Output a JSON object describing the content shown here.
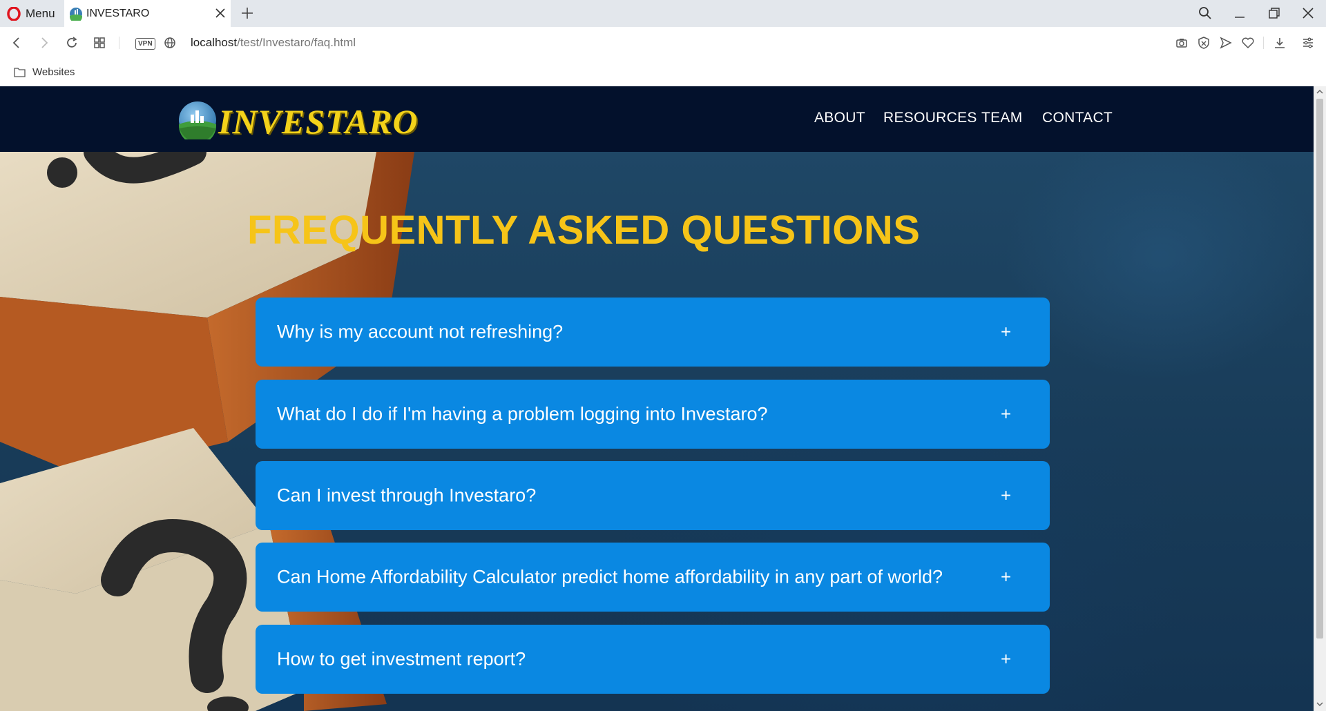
{
  "browser": {
    "menu_label": "Menu",
    "tab_title": "INVESTARO",
    "url_host": "localhost",
    "url_path": "/test/Investaro/faq.html",
    "vpn_label": "VPN",
    "bookmark_folder": "Websites"
  },
  "site": {
    "logo_text": "INVESTARO",
    "nav": [
      "ABOUT",
      "RESOURCES",
      "TEAM",
      "CONTACT"
    ]
  },
  "faq": {
    "title": "FREQUENTLY ASKED QUESTIONS",
    "items": [
      {
        "question": "Why is my account not refreshing?",
        "toggle": "+"
      },
      {
        "question": "What do I do if I'm having a problem logging into Investaro?",
        "toggle": "+"
      },
      {
        "question": "Can I invest through Investaro?",
        "toggle": "+"
      },
      {
        "question": "Can Home Affordability Calculator predict home affordability in any part of world?",
        "toggle": "+"
      },
      {
        "question": "How to get investment report?",
        "toggle": "+"
      }
    ]
  },
  "colors": {
    "nav_bg": "#03112c",
    "title_yellow": "#f6c418",
    "accordion_blue": "#0a88e2",
    "logo_yellow": "#f3d21a"
  }
}
